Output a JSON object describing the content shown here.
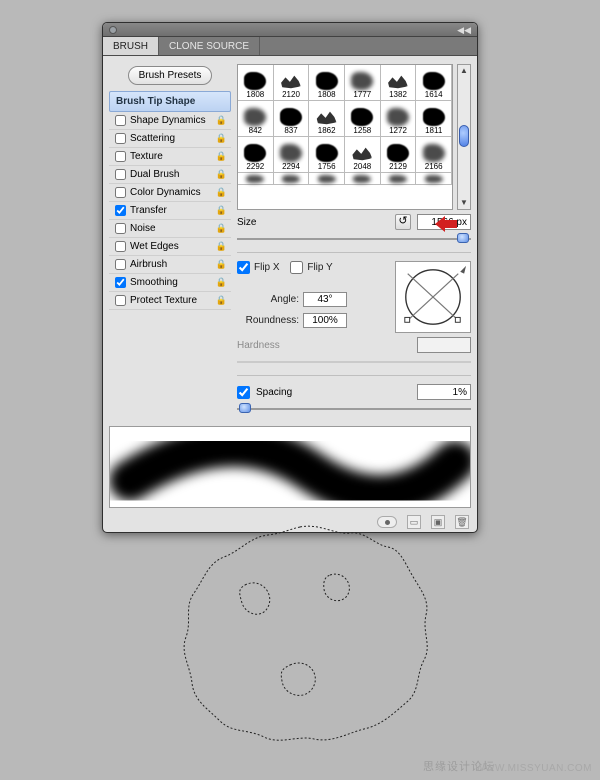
{
  "tabs": {
    "brush": "BRUSH",
    "clone": "CLONE SOURCE"
  },
  "presets_button": "Brush Presets",
  "options": {
    "header": "Brush Tip Shape",
    "items": [
      {
        "label": "Shape Dynamics",
        "checked": false,
        "locked": true
      },
      {
        "label": "Scattering",
        "checked": false,
        "locked": true
      },
      {
        "label": "Texture",
        "checked": false,
        "locked": true
      },
      {
        "label": "Dual Brush",
        "checked": false,
        "locked": true
      },
      {
        "label": "Color Dynamics",
        "checked": false,
        "locked": true
      },
      {
        "label": "Transfer",
        "checked": true,
        "locked": true
      },
      {
        "label": "Noise",
        "checked": false,
        "locked": true
      },
      {
        "label": "Wet Edges",
        "checked": false,
        "locked": true
      },
      {
        "label": "Airbrush",
        "checked": false,
        "locked": true
      },
      {
        "label": "Smoothing",
        "checked": true,
        "locked": true
      },
      {
        "label": "Protect Texture",
        "checked": false,
        "locked": true
      }
    ]
  },
  "brush_cells": [
    [
      "1808",
      "2120",
      "1808",
      "1777",
      "1382",
      "1614"
    ],
    [
      "842",
      "837",
      "1862",
      "1258",
      "1272",
      "1811"
    ],
    [
      "2292",
      "2294",
      "1756",
      "2048",
      "2129",
      "2166"
    ]
  ],
  "size": {
    "label": "Size",
    "value": "1566 px"
  },
  "flip": {
    "x_label": "Flip X",
    "y_label": "Flip Y",
    "x": true,
    "y": false
  },
  "angle": {
    "label": "Angle:",
    "value": "43°"
  },
  "roundness": {
    "label": "Roundness:",
    "value": "100%"
  },
  "hardness": {
    "label": "Hardness"
  },
  "spacing": {
    "label": "Spacing",
    "checked": true,
    "value": "1%"
  },
  "watermark": {
    "left": "思缘设计论坛",
    "right": "WWW.MISSYUAN.COM"
  }
}
